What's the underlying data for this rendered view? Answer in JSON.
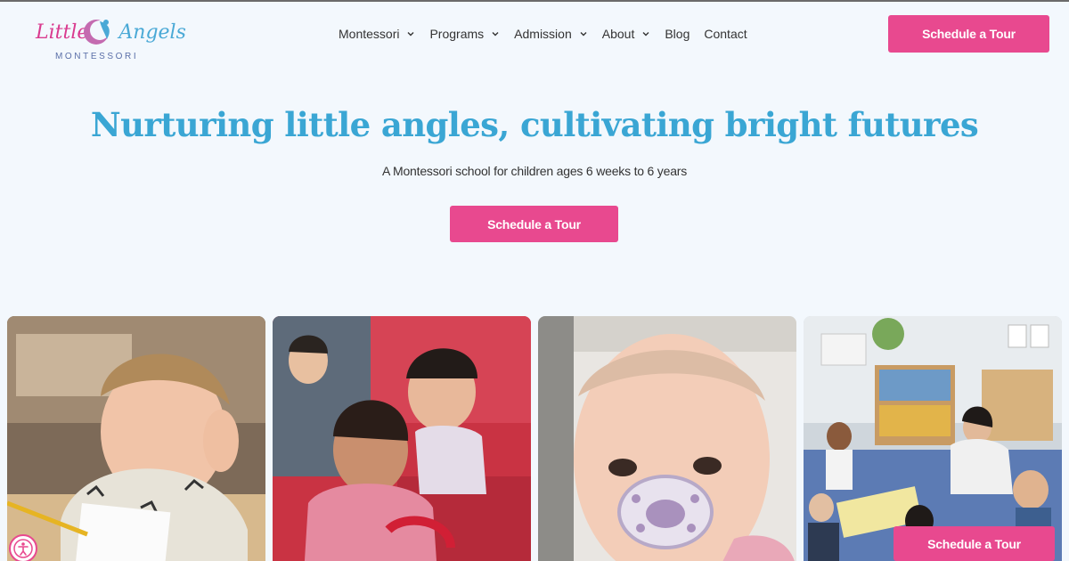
{
  "header": {
    "logo": {
      "script_word_1": "Little",
      "script_word_2": "Angels",
      "subtitle": "MONTESSORI"
    },
    "nav": [
      {
        "label": "Montessori",
        "has_dropdown": true
      },
      {
        "label": "Programs",
        "has_dropdown": true
      },
      {
        "label": "Admission",
        "has_dropdown": true
      },
      {
        "label": "About",
        "has_dropdown": true
      },
      {
        "label": "Blog",
        "has_dropdown": false
      },
      {
        "label": "Contact",
        "has_dropdown": false
      }
    ],
    "cta_label": "Schedule a Tour"
  },
  "hero": {
    "title": "Nurturing little angles, cultivating bright futures",
    "subtitle": "A Montessori school for children ages 6 weeks to 6 years",
    "cta_label": "Schedule a Tour"
  },
  "photos": [
    {
      "name": "boy-with-worksheet-photo"
    },
    {
      "name": "toddlers-on-red-stairs-photo"
    },
    {
      "name": "baby-with-pacifier-photo"
    },
    {
      "name": "classroom-circle-photo"
    }
  ],
  "floating_cta": {
    "label": "Schedule a Tour"
  },
  "accessibility": {
    "icon": "accessibility-icon"
  },
  "colors": {
    "brand_pink": "#e8498f",
    "brand_blue": "#3aa6d4",
    "background": "#f3f8fd",
    "nav_text": "#333333"
  }
}
